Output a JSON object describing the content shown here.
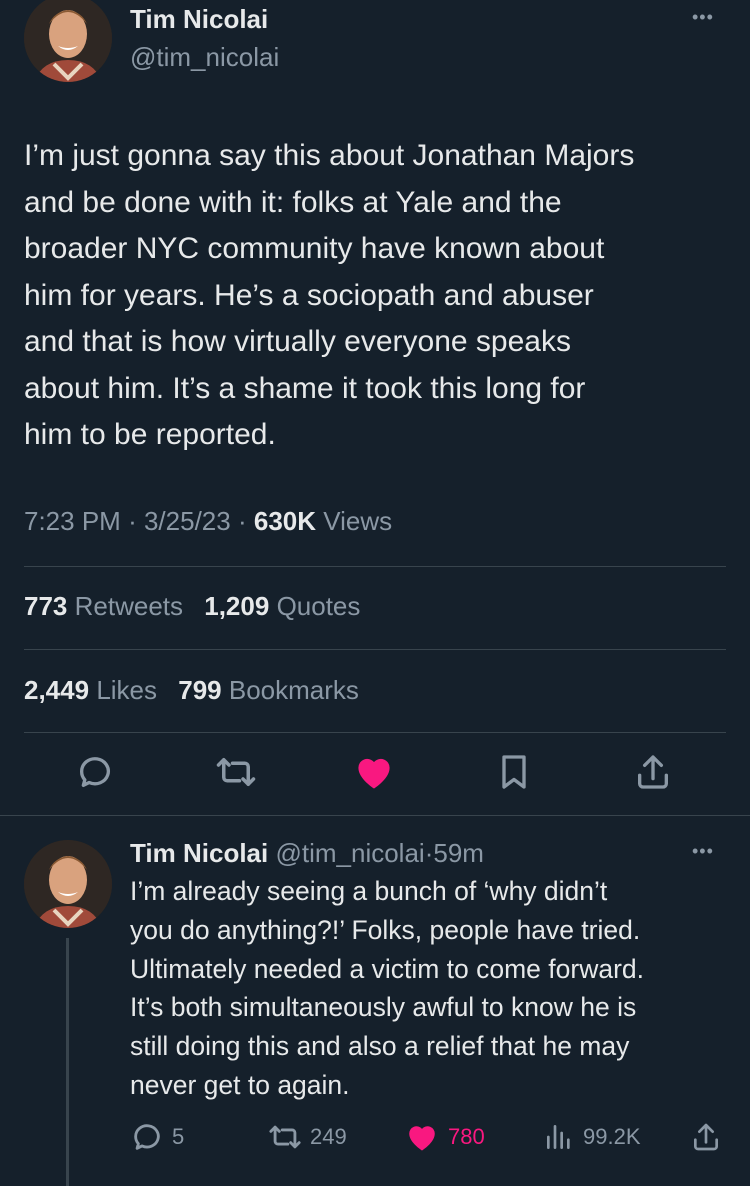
{
  "main_tweet": {
    "author_name": "Tim Nicolai",
    "author_handle": "@tim_nicolai",
    "more_label": "•••",
    "body": "I’m just gonna say this about Jonathan Majors\nand be done with it: folks at Yale and the\nbroader NYC community have known about\nhim for years. He’s a sociopath and abuser\nand that is how virtually everyone speaks\nabout him. It’s a shame it took this long for\nhim to be reported.",
    "time": "7:23 PM",
    "date": "3/25/23",
    "separator": "·",
    "views_count": "630K",
    "views_label": "Views",
    "retweets_count": "773",
    "retweets_label": "Retweets",
    "quotes_count": "1,209",
    "quotes_label": "Quotes",
    "likes_count": "2,449",
    "likes_label": "Likes",
    "bookmarks_count": "799",
    "bookmarks_label": "Bookmarks",
    "actions": [
      "reply-icon",
      "retweet-icon",
      "heart-filled-icon",
      "bookmark-icon",
      "share-icon"
    ],
    "liked": true
  },
  "reply_tweet": {
    "author_name": "Tim Nicolai",
    "author_handle": "@tim_nicolai",
    "separator": "·",
    "time_ago": "59m",
    "more_label": "•••",
    "body": "I’m already seeing a bunch of ‘why didn’t\nyou do anything?!’ Folks, people have tried.\nUltimately needed a victim to come forward.\nIt’s both simultaneously awful to know he is\nstill doing this and also a relief that he may\nnever get to again.",
    "replies": "5",
    "retweets": "249",
    "likes": "780",
    "views": "99.2K",
    "liked": true
  },
  "colors": {
    "background": "#15202b",
    "text_primary": "#e7e9ea",
    "text_secondary": "#8b98a5",
    "divider": "#38444d",
    "like": "#f91880"
  }
}
